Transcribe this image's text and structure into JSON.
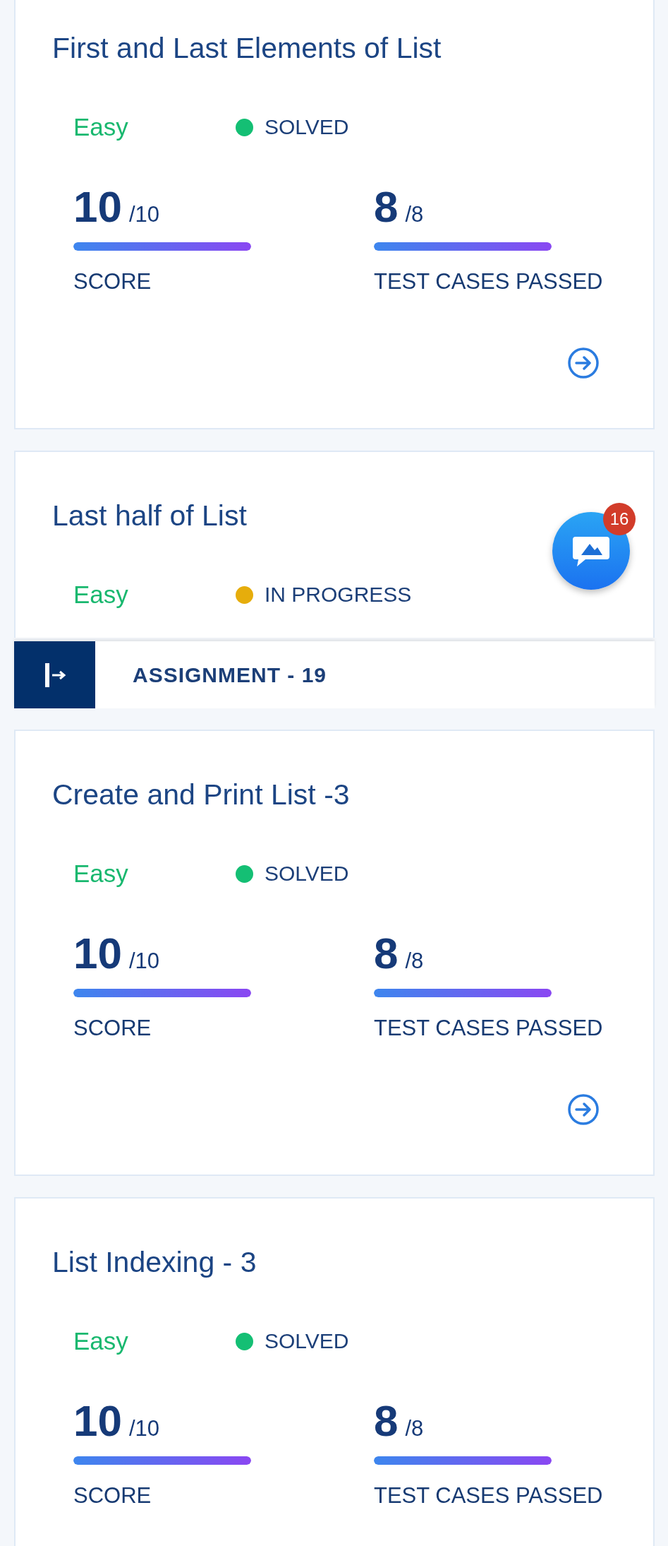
{
  "sections": [
    {
      "cards": [
        {
          "title": "First and Last Elements of List",
          "difficulty": "Easy",
          "status": {
            "label": "SOLVED",
            "color": "#14bf74"
          },
          "stats": [
            {
              "value": "10",
              "total": "/10",
              "label": "SCORE",
              "level": 1
            },
            {
              "value": "8",
              "total": "/8",
              "label": "TEST CASES PASSED",
              "level": 1
            }
          ],
          "open_arrow": true
        },
        {
          "title": "Last half of List",
          "difficulty": "Easy",
          "status": {
            "label": "IN PROGRESS",
            "color": "#e6ad0c"
          },
          "open_arrow": false
        }
      ]
    },
    {
      "title": "ASSIGNMENT - 19",
      "cards": [
        {
          "title": "Create and Print List -3",
          "difficulty": "Easy",
          "status": {
            "label": "SOLVED",
            "color": "#14bf74"
          },
          "stats": [
            {
              "value": "10",
              "total": "/10",
              "label": "SCORE",
              "level": 1
            },
            {
              "value": "8",
              "total": "/8",
              "label": "TEST CASES PASSED",
              "level": 1
            }
          ],
          "open_arrow": true
        },
        {
          "title": "List Indexing - 3",
          "difficulty": "Easy",
          "status": {
            "label": "SOLVED",
            "color": "#14bf74"
          },
          "stats": [
            {
              "value": "10",
              "total": "/10",
              "label": "SCORE",
              "level": 1
            },
            {
              "value": "8",
              "total": "/8",
              "label": "TEST CASES PASSED",
              "level": 1
            }
          ],
          "open_arrow": false
        }
      ]
    }
  ],
  "chat": {
    "badge": "16"
  }
}
